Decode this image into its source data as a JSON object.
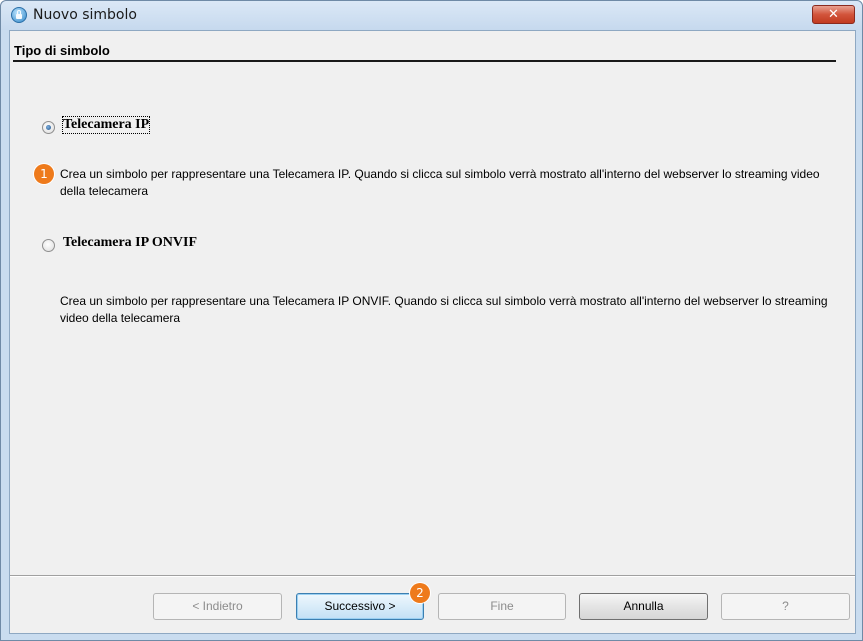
{
  "window": {
    "title": "Nuovo simbolo",
    "close_label": "✕"
  },
  "section": {
    "title": "Tipo di simbolo"
  },
  "options": [
    {
      "label": "Telecamera IP",
      "selected": true,
      "description": "Crea un simbolo per rappresentare una Telecamera IP. Quando si clicca sul simbolo verrà mostrato all'interno del webserver lo streaming video della telecamera"
    },
    {
      "label": "Telecamera IP ONVIF",
      "selected": false,
      "description": "Crea un simbolo per rappresentare una Telecamera IP ONVIF. Quando si clicca sul simbolo verrà mostrato all'interno del webserver lo streaming video della telecamera"
    }
  ],
  "callouts": {
    "first": "1",
    "second": "2",
    "color": "#ee7a1b"
  },
  "buttons": {
    "back": "< Indietro",
    "next": "Successivo >",
    "finish": "Fine",
    "cancel": "Annulla",
    "help": "?"
  },
  "icons": {
    "app": "lock-globe-icon",
    "close": "close-icon"
  }
}
